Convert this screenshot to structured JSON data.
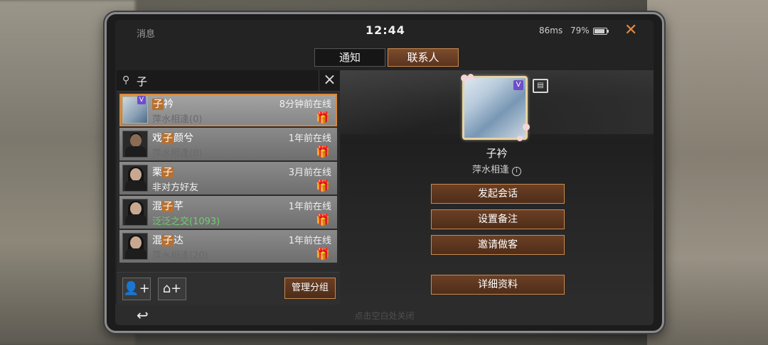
{
  "topbar": {
    "title": "消息",
    "time": "12:44",
    "ping": "86ms",
    "battery": "79%"
  },
  "tabs": [
    {
      "label": "通知",
      "active": false
    },
    {
      "label": "联系人",
      "active": true
    }
  ],
  "search": {
    "query": "子"
  },
  "contacts": [
    {
      "pre": "",
      "hl": "子",
      "post": "衿",
      "status": "8分钟前在线",
      "group": "萍水相逢(0)",
      "group_style": "gray",
      "selected": true,
      "vip": "V"
    },
    {
      "pre": "戏",
      "hl": "子",
      "post": "颜兮",
      "status": "1年前在线",
      "group": "萍水相逢(0)",
      "group_style": "gray"
    },
    {
      "pre": "栗",
      "hl": "子",
      "post": "",
      "status": "3月前在线",
      "group": "非对方好友",
      "group_style": "white"
    },
    {
      "pre": "混",
      "hl": "子",
      "post": "芊",
      "status": "1年前在线",
      "group": "泛泛之交(1093)",
      "group_style": "green"
    },
    {
      "pre": "混",
      "hl": "子",
      "post": "达",
      "status": "1年前在线",
      "group": "萍水相逢(20)",
      "group_style": "gray"
    }
  ],
  "left_footer": {
    "manage_label": "管理分组"
  },
  "profile": {
    "name": "子衿",
    "group": "萍水相逢",
    "vip": "V"
  },
  "actions": {
    "chat": "发起会话",
    "remark": "设置备注",
    "invite": "邀请做客",
    "details": "详细资料"
  },
  "bottom": {
    "hint": "点击空白处关闭"
  },
  "colors": {
    "accent": "#c98a4e",
    "highlight": "#b8702e",
    "close": "#e38a3d",
    "friendship_green": "#6fcf6f"
  }
}
